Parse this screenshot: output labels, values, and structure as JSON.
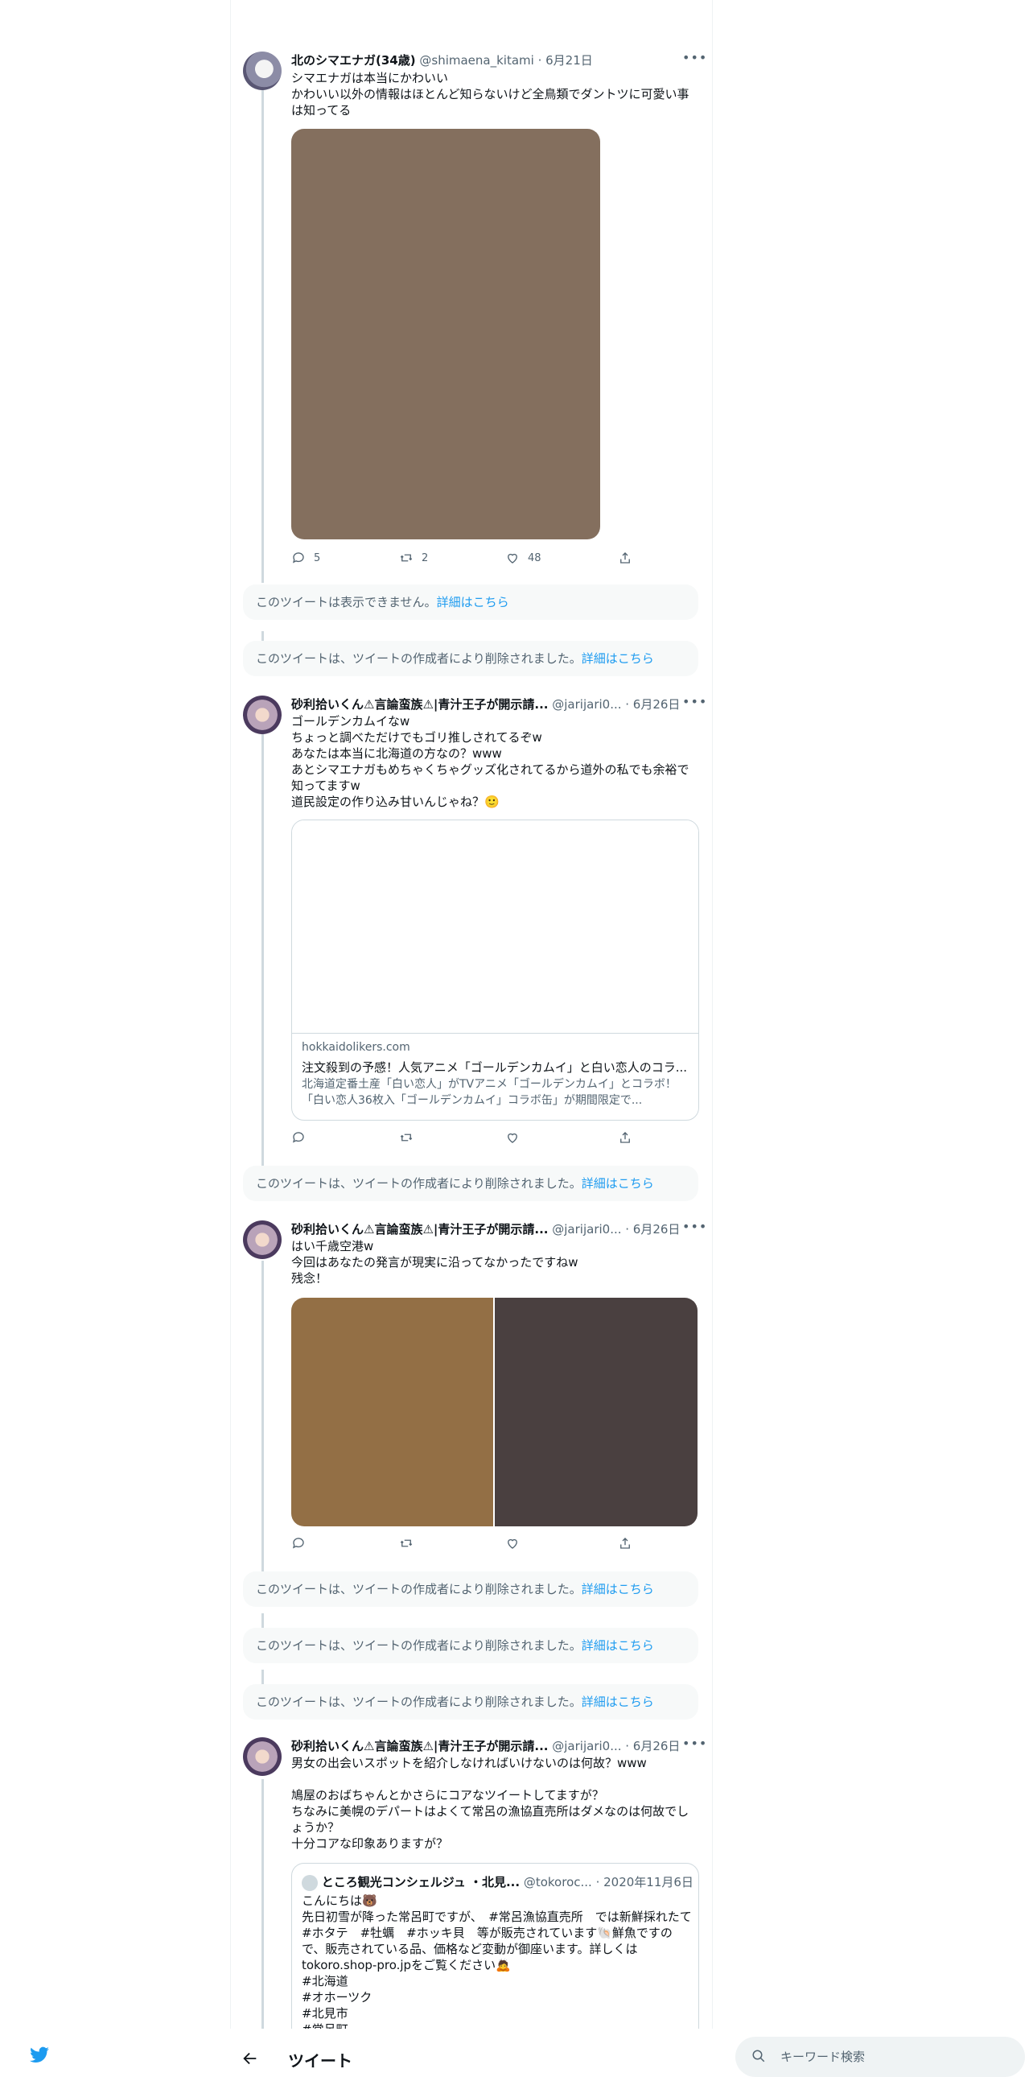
{
  "header": {
    "title": "ツイート",
    "back_icon": "arrow-left-icon"
  },
  "search": {
    "placeholder": "キーワード検索"
  },
  "notice_link": "詳細はこちら",
  "tweets": [
    {
      "name": "北のシマエナガ(34歳)",
      "meta": "@shimaena_kitami · 6月21日",
      "text": "シマエナガは本当にかわいい\nかわいい以外の情報はほとんど知らないけど全鳥類でダントツに可愛い事は知ってる",
      "replies": "5",
      "retweets": "2",
      "likes": "48",
      "image_color": "#846f5e"
    },
    {
      "name": "砂利拾いくん⚠言論蛮族⚠|青汁王子が開示請...",
      "meta": "@jarijari0... · 6月26日",
      "text": "ゴールデンカムイなw\nちょっと調べただけでもゴリ推しされてるぞw\nあなたは本当に北海道の方なの？www\nあとシマエナガもめちゃくちゃグッズ化されてるから道外の私でも余裕で知ってますw\n道民設定の作り込み甘いんじゃね？🙂",
      "card": {
        "domain": "hokkaidolikers.com",
        "title": "注文殺到の予感！人気アニメ「ゴールデンカムイ」と白い恋人のコラ...",
        "desc": "北海道定番土産「白い恋人」がTVアニメ「ゴールデンカムイ」とコラボ！「白い恋人36枚入「ゴールデンカムイ」コラボ缶」が期間限定で..."
      }
    },
    {
      "name": "砂利拾いくん⚠言論蛮族⚠|青汁王子が開示請...",
      "meta": "@jarijari0... · 6月26日",
      "text": "はい千歳空港w\n今回はあなたの発言が現実に沿ってなかったですねw\n残念！",
      "image_left_color": "#936f45",
      "image_right_color": "#4a4040"
    },
    {
      "name": "砂利拾いくん⚠言論蛮族⚠|青汁王子が開示請...",
      "meta": "@jarijari0... · 6月26日",
      "text": "男女の出会いスポットを紹介しなければいけないのは何故？www\n\n鳩屋のおばちゃんとかさらにコアなツイートしてますが？\nちなみに美幌のデパートはよくて常呂の漁協直売所はダメなのは何故でしょうか？\n十分コアな印象ありますが？",
      "quote": {
        "name": "ところ観光コンシェルジュ ・北見...",
        "meta": "@tokoroc... · 2020年11月6日",
        "text": "こんにちは🐻\n先日初雪が降った常呂町ですが、　#常呂漁協直売所　では新鮮採れたて　#ホタテ　#牡蠣　#ホッキ貝　等が販売されています🐚鮮魚ですので、販売されている品、価格など変動が御座います。詳しくはtokoro.shop-pro.jpをご覧ください🙇\n#北海道\n#オホーツク\n#北見市\n#常呂町"
      }
    }
  ],
  "notices": [
    {
      "text": "このツイートは表示できません。"
    },
    {
      "text": "このツイートは、ツイートの作成者により削除されました。"
    },
    {
      "text": "このツイートは、ツイートの作成者により削除されました。"
    },
    {
      "text": "このツイートは、ツイートの作成者により削除されました。"
    },
    {
      "text": "このツイートは、ツイートの作成者により削除されました。"
    },
    {
      "text": "このツイートは、ツイートの作成者により削除されました。"
    }
  ]
}
